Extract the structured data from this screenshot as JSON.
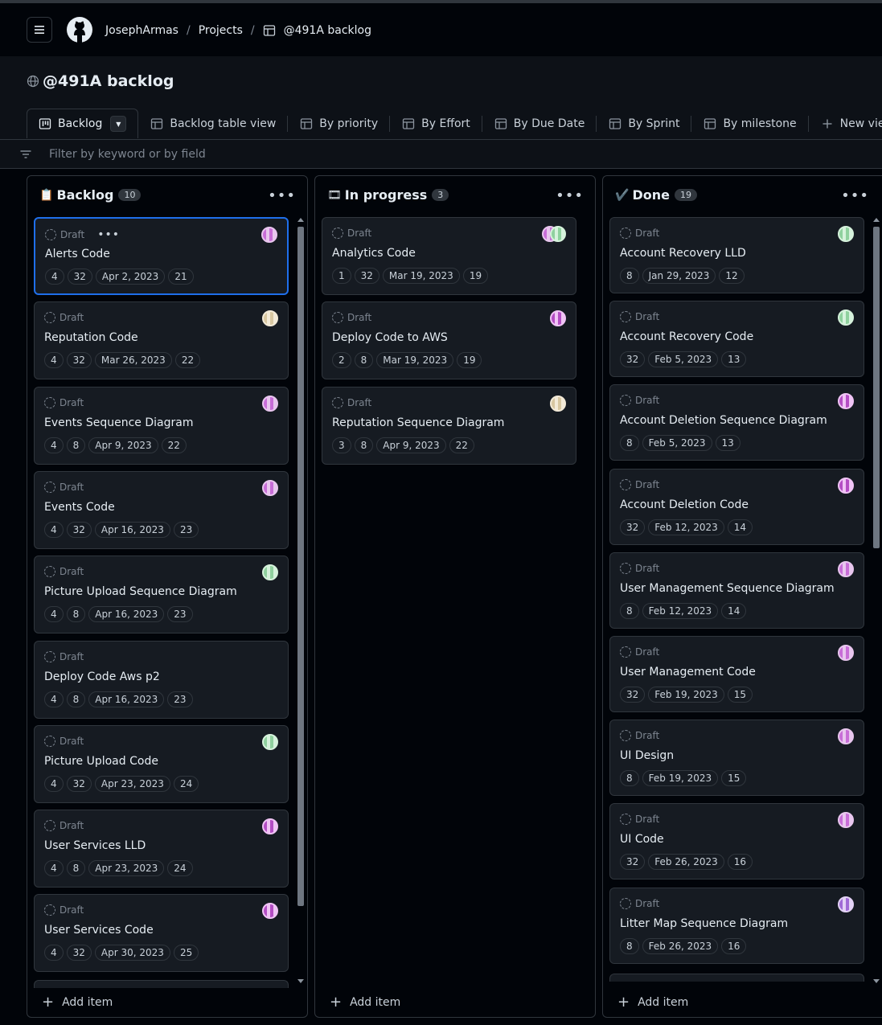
{
  "header": {
    "breadcrumbs": [
      "JosephArmas",
      "Projects",
      "@491A backlog"
    ],
    "menu_icon": "hamburger-icon",
    "logo_icon": "github-icon"
  },
  "project": {
    "title": "@491A backlog"
  },
  "tabs": [
    {
      "label": "Backlog",
      "icon": "board-icon",
      "active": true
    },
    {
      "label": "Backlog table view",
      "icon": "table-icon"
    },
    {
      "label": "By priority",
      "icon": "table-icon"
    },
    {
      "label": "By Effort",
      "icon": "table-icon"
    },
    {
      "label": "By Due Date",
      "icon": "table-icon"
    },
    {
      "label": "By Sprint",
      "icon": "table-icon"
    },
    {
      "label": "By milestone",
      "icon": "table-icon"
    },
    {
      "label": "New view",
      "icon": "plus-icon"
    }
  ],
  "filter": {
    "placeholder": "Filter by keyword or by field"
  },
  "colors": {
    "accent": "#1f6feb",
    "bg": "#010409",
    "card": "#161b22",
    "border": "#30363d"
  },
  "columns": [
    {
      "emoji": "📋",
      "title": "Backlog",
      "count": "10",
      "add_label": "Add item",
      "cards": [
        {
          "status": "Draft",
          "title": "Alerts Code",
          "chips": [
            "4",
            "32",
            "Apr 2, 2023",
            "21"
          ],
          "avatar": "purple",
          "selected": true
        },
        {
          "status": "Draft",
          "title": "Reputation Code",
          "chips": [
            "4",
            "32",
            "Mar 26, 2023",
            "22"
          ],
          "avatar": "tan"
        },
        {
          "status": "Draft",
          "title": "Events Sequence Diagram",
          "chips": [
            "4",
            "8",
            "Apr 9, 2023",
            "22"
          ],
          "avatar": "purple"
        },
        {
          "status": "Draft",
          "title": "Events Code",
          "chips": [
            "4",
            "32",
            "Apr 16, 2023",
            "23"
          ],
          "avatar": "purple"
        },
        {
          "status": "Draft",
          "title": "Picture Upload Sequence Diagram",
          "chips": [
            "4",
            "8",
            "Apr 16, 2023",
            "23"
          ],
          "avatar": "green"
        },
        {
          "status": "Draft",
          "title": "Deploy Code Aws p2",
          "chips": [
            "4",
            "8",
            "Apr 16, 2023",
            "23"
          ],
          "avatar": "none"
        },
        {
          "status": "Draft",
          "title": "Picture Upload Code",
          "chips": [
            "4",
            "32",
            "Apr 23, 2023",
            "24"
          ],
          "avatar": "green"
        },
        {
          "status": "Draft",
          "title": "User Services LLD",
          "chips": [
            "4",
            "8",
            "Apr 23, 2023",
            "24"
          ],
          "avatar": "magenta"
        },
        {
          "status": "Draft",
          "title": "User Services Code",
          "chips": [
            "4",
            "32",
            "Apr 30, 2023",
            "25"
          ],
          "avatar": "magenta"
        }
      ]
    },
    {
      "emoji": "🎞",
      "title": "In progress",
      "count": "3",
      "add_label": "Add item",
      "cards": [
        {
          "status": "Draft",
          "title": "Analytics Code",
          "chips": [
            "1",
            "32",
            "Mar 19, 2023",
            "19"
          ],
          "avatar": "double"
        },
        {
          "status": "Draft",
          "title": "Deploy Code to AWS",
          "chips": [
            "2",
            "8",
            "Mar 19, 2023",
            "19"
          ],
          "avatar": "magenta"
        },
        {
          "status": "Draft",
          "title": "Reputation Sequence Diagram",
          "chips": [
            "3",
            "8",
            "Apr 9, 2023",
            "22"
          ],
          "avatar": "tan"
        }
      ]
    },
    {
      "emoji": "✔️",
      "title": "Done",
      "count": "19",
      "add_label": "Add item",
      "cards": [
        {
          "status": "Draft",
          "title": "Account Recovery LLD",
          "chips": [
            "8",
            "Jan 29, 2023",
            "12"
          ],
          "avatar": "green"
        },
        {
          "status": "Draft",
          "title": "Account Recovery Code",
          "chips": [
            "32",
            "Feb 5, 2023",
            "13"
          ],
          "avatar": "green"
        },
        {
          "status": "Draft",
          "title": "Account Deletion Sequence Diagram",
          "chips": [
            "8",
            "Feb 5, 2023",
            "13"
          ],
          "avatar": "magenta"
        },
        {
          "status": "Draft",
          "title": "Account Deletion Code",
          "chips": [
            "32",
            "Feb 12, 2023",
            "14"
          ],
          "avatar": "magenta"
        },
        {
          "status": "Draft",
          "title": "User Management Sequence Diagram",
          "chips": [
            "8",
            "Feb 12, 2023",
            "14"
          ],
          "avatar": "purple"
        },
        {
          "status": "Draft",
          "title": "User Management Code",
          "chips": [
            "32",
            "Feb 19, 2023",
            "15"
          ],
          "avatar": "purple"
        },
        {
          "status": "Draft",
          "title": "UI Design",
          "chips": [
            "8",
            "Feb 19, 2023",
            "15"
          ],
          "avatar": "purple"
        },
        {
          "status": "Draft",
          "title": "UI Code",
          "chips": [
            "32",
            "Feb 26, 2023",
            "16"
          ],
          "avatar": "purple"
        },
        {
          "status": "Draft",
          "title": "Litter Map Sequence Diagram",
          "chips": [
            "8",
            "Feb 26, 2023",
            "16"
          ],
          "avatar": "indigo"
        }
      ]
    }
  ]
}
